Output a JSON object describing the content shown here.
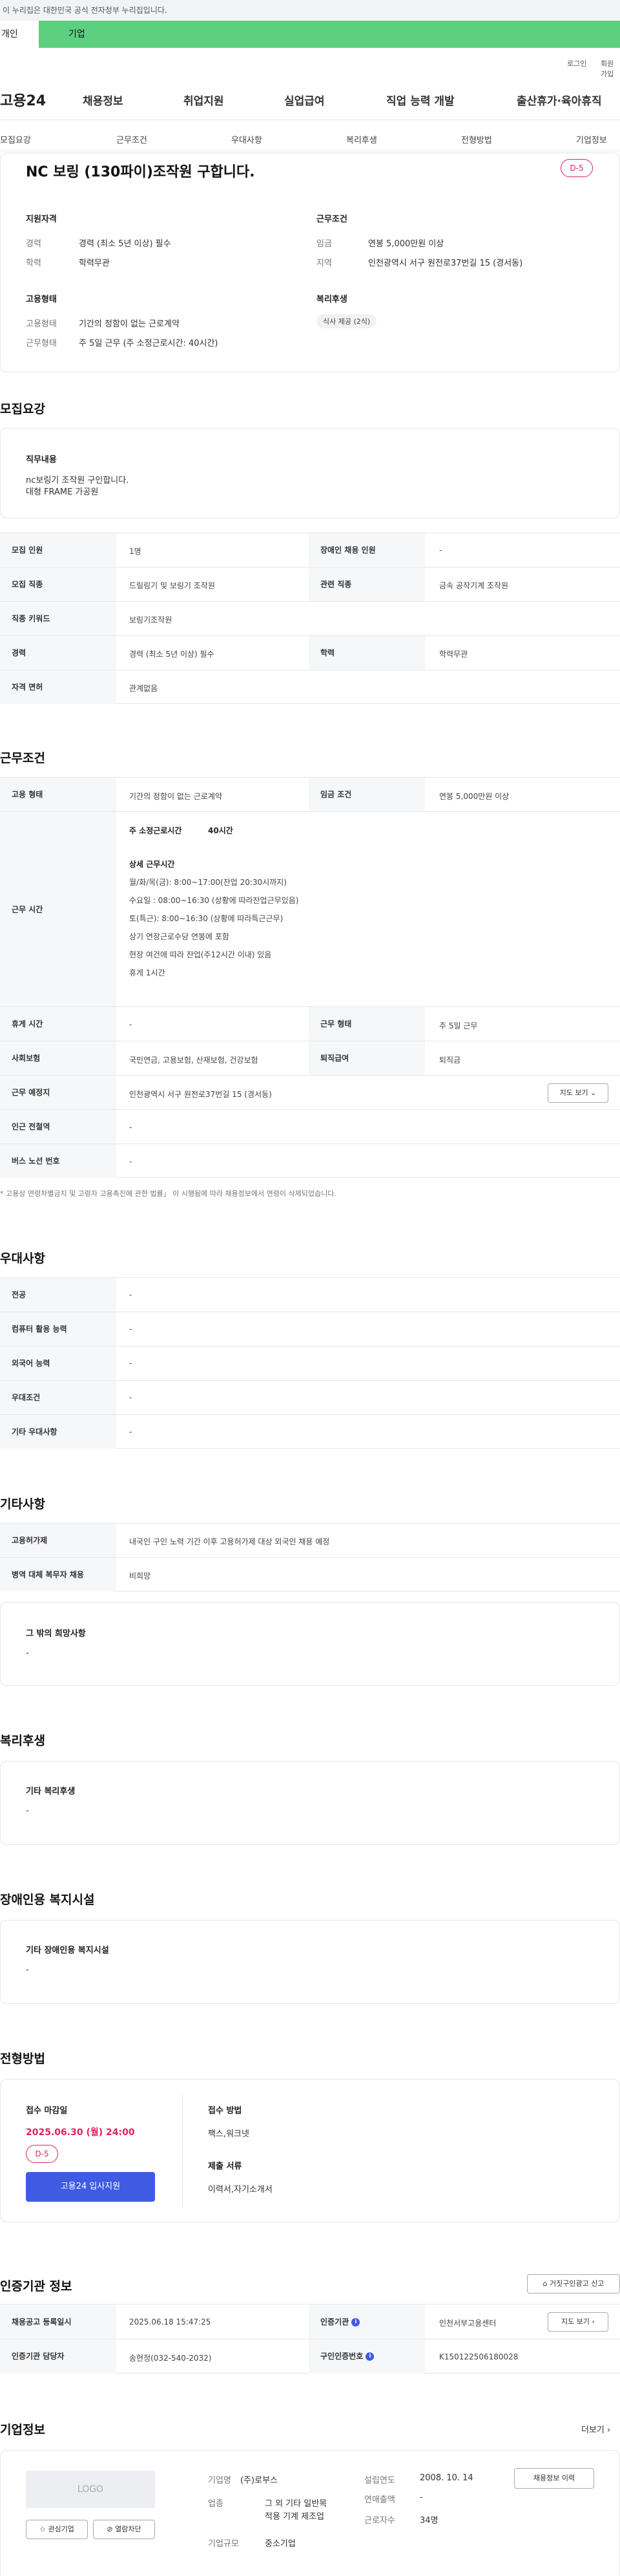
{
  "banner": {
    "text": "이 누리집은 대한민국 공식 전자정부 누리집입니다."
  },
  "member_tabs": {
    "individual": "개인",
    "business": "기업"
  },
  "util": {
    "login": "로그인",
    "join": "회원가입"
  },
  "gnb": {
    "logo": "고용24",
    "items": [
      "채용정보",
      "취업지원",
      "실업급여",
      "직업 능력 개발",
      "출산휴가·육아휴직"
    ]
  },
  "anchor_tabs": [
    "모집요강",
    "근무조건",
    "우대사항",
    "복리후생",
    "전형방법",
    "기업정보"
  ],
  "job": {
    "title": "NC 보링 (130파이)조작원 구합니다.",
    "dday": "D-5"
  },
  "summary": {
    "qual_title": "지원자격",
    "qual_rows": [
      {
        "label": "경력",
        "value": "경력 (최소 5년 이상) 필수"
      },
      {
        "label": "학력",
        "value": "학력무관"
      }
    ],
    "cond_title": "근무조건",
    "cond_rows": [
      {
        "label": "임금",
        "value": "연봉 5,000만원 이상"
      },
      {
        "label": "지역",
        "value": "인천광역시 서구 원전로37번길 15 (경서동)"
      }
    ],
    "emp_title": "고용형태",
    "emp_rows": [
      {
        "label": "고용형태",
        "value": "기간의 정함이 없는 근로계약"
      },
      {
        "label": "근무형태",
        "value": "주 5일 근무 (주 소정근로시간: 40시간)"
      }
    ],
    "welfare_title": "복리후생",
    "welfare_chip": "식사 제공 (2식)"
  },
  "recruit": {
    "title": "모집요강",
    "duty_label": "직무내용",
    "duty_lines": [
      "nc보링기 조작원 구인합니다.",
      "대형 FRAME 가공원"
    ],
    "rows": [
      [
        "모집 인원",
        "1명",
        "장애인 채용 인원",
        "-"
      ],
      [
        "모집 직종",
        "드릴링기 및 보링기 조작원",
        "관련 직종",
        "금속 공작기계 조작원"
      ],
      [
        "직종 키워드",
        "보링기조작원",
        "",
        ""
      ],
      [
        "경력",
        "경력 (최소 5년 이상) 필수",
        "학력",
        "학력무관"
      ],
      [
        "자격 면허",
        "관계없음",
        "",
        ""
      ]
    ]
  },
  "work": {
    "title": "근무조건",
    "emp_type_label": "고용 형태",
    "emp_type": "기간의 정함이 없는 근로계약",
    "wage_label": "임금 조건",
    "wage": "연봉 5,000만원 이상",
    "time_label": "근무 시간",
    "weekly": "주 소정근로시간",
    "weekly_val": "40시간",
    "detail_title": "상세 근무시간",
    "detail_lines": [
      "월/화/목(금): 8:00~17:00(잔업 20:30시까지)",
      "수요일 : 08:00~16:30 (상황에 따라잔업근무있음)",
      "토(특근): 8:00~16:30 (상황에 따라특근근무)",
      "상기 연장근로수당 연봉에 포함",
      "현장 여건에 따라 잔업(주12시간 이내) 있음",
      "휴게 1시간"
    ],
    "rest_label": "휴게 시간",
    "rest": "-",
    "shift_label": "근무 형태",
    "shift": "주 5일 근무",
    "ins_label": "사회보험",
    "ins": "국민연금, 고용보험, 산재보험, 건강보험",
    "ret_label": "퇴직급여",
    "ret": "퇴직금",
    "place_label": "근무 예정지",
    "place": "인천광역시 서구 원전로37번길 15 (경서동)",
    "map_btn": "지도 보기",
    "subway_label": "인근 전철역",
    "subway": "-",
    "bus_label": "버스 노선 번호",
    "bus": "-",
    "note": "* 고용상 연령차별금지 및 고령자 고용촉진에 관한 법률」 이 시행됨에 따라 채용정보에서 연령이 삭제되었습니다."
  },
  "pref": {
    "title": "우대사항",
    "rows": [
      [
        "전공",
        "-"
      ],
      [
        "컴퓨터 활용 능력",
        "-"
      ],
      [
        "외국어 능력",
        "-"
      ],
      [
        "우대조건",
        "-"
      ],
      [
        "기타 우대사항",
        "-"
      ]
    ]
  },
  "etc": {
    "title": "기타사항",
    "rows": [
      [
        "고용허가제",
        "내국인 구인 노력 기간 이후 고용허가제 대상 외국인 채용 예정"
      ],
      [
        "병역 대체 복무자 채용",
        "비희망"
      ]
    ],
    "extra_label": "그 밖의 희망사항",
    "extra_val": "-"
  },
  "welfare": {
    "title": "복리후생",
    "label": "기타 복리후생",
    "val": "-"
  },
  "disab": {
    "title": "장애인용 복지시설",
    "label": "기타 장애인용 복지시설",
    "val": "-"
  },
  "process": {
    "title": "전형방법",
    "deadline_label": "접수 마감일",
    "deadline": "2025.06.30 (월) 24:00",
    "dday": "D-5",
    "apply_btn": "고용24 입사지원",
    "method_label": "접수 방법",
    "method": "팩스,워크넷",
    "docs_label": "제출 서류",
    "docs": "이력서,자기소개서"
  },
  "cert": {
    "title": "인증기관 정보",
    "report_btn": "거짓구인광고 신고",
    "reg_label": "채용공고 등록일시",
    "reg": "2025.06.18 15:47:25",
    "org_label": "인증기관",
    "org": "인천서부고용센터",
    "map_btn": "지도 보기",
    "mgr_label": "인증기관 담당자",
    "mgr": "송현정(032-540-2032)",
    "no_label": "구인인증번호",
    "no": "K150122506180028"
  },
  "company": {
    "title": "기업정보",
    "more": "더보기",
    "logo": "LOGO",
    "fav_btn": "관심기업",
    "block_btn": "열람차단",
    "name_label": "기업명",
    "name": "(주)로부스",
    "year_label": "설립연도",
    "year": "2008. 10. 14",
    "ind_label": "업종",
    "ind_lines": [
      "그 외 기타 일반목",
      "적용 기계 제조업"
    ],
    "sales_label": "연매출액",
    "sales": "-",
    "emp_label": "근로자수",
    "emp": "34명",
    "scale_label": "기업규모",
    "scale": "중소기업",
    "view_btn": "채용정보 이력"
  },
  "colors": {
    "accent": "#3f5be4",
    "dday": "#e0245e",
    "biz_tab": "#5dd07f"
  }
}
